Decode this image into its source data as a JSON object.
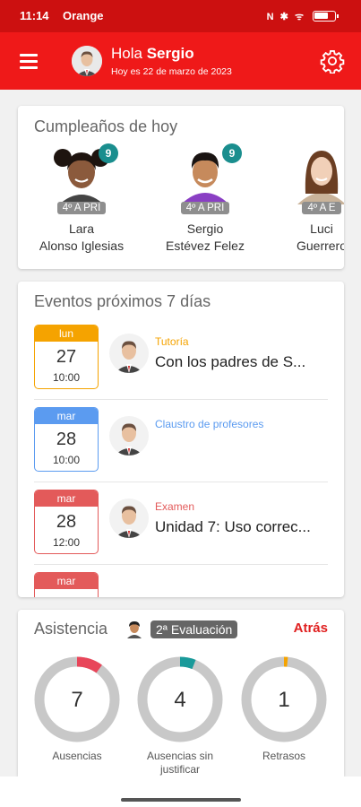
{
  "status_bar": {
    "time": "11:14",
    "carrier": "Orange",
    "icons_text": "N ✱ ᯤ"
  },
  "header": {
    "greeting": "Hola",
    "user_name": "Sergio",
    "date": "Hoy es 22 de marzo de 2023"
  },
  "birthdays": {
    "title": "Cumpleaños de hoy",
    "people": [
      {
        "first": "Lara",
        "last": "Alonso Iglesias",
        "class": "4º A PRI",
        "age": "9"
      },
      {
        "first": "Sergio",
        "last": "Estévez Felez",
        "class": "4º A PRI",
        "age": "9"
      },
      {
        "first": "Luci",
        "last": "Guerrero",
        "class": "4º A E"
      }
    ]
  },
  "events": {
    "title": "Eventos próximos 7 días",
    "items": [
      {
        "day": "lun",
        "num": "27",
        "time": "10:00",
        "type": "Tutoría",
        "title": "Con los padres de S...",
        "color": "#f5a300"
      },
      {
        "day": "mar",
        "num": "28",
        "time": "10:00",
        "type": "Claustro de profesores",
        "title": "",
        "color": "#5b9bf0"
      },
      {
        "day": "mar",
        "num": "28",
        "time": "12:00",
        "type": "Examen",
        "title": "Unidad 7: Uso correc...",
        "color": "#e35a5a"
      },
      {
        "day": "mar",
        "num": "",
        "time": "",
        "type": "",
        "title": "",
        "color": "#e35a5a"
      }
    ]
  },
  "attendance": {
    "title": "Asistencia",
    "period": "2ª Evaluación",
    "back": "Atrás",
    "stats": [
      {
        "value": "7",
        "label": "Ausencias",
        "fraction": 0.1,
        "color": "#e8465a"
      },
      {
        "value": "4",
        "label": "Ausencias sin justificar",
        "fraction": 0.06,
        "color": "#1a9a9a"
      },
      {
        "value": "1",
        "label": "Retrasos",
        "fraction": 0.015,
        "color": "#f5a300"
      }
    ]
  },
  "colors": {
    "brand": "#ef1919",
    "status": "#cc1010",
    "badge": "#1a8e8e"
  }
}
